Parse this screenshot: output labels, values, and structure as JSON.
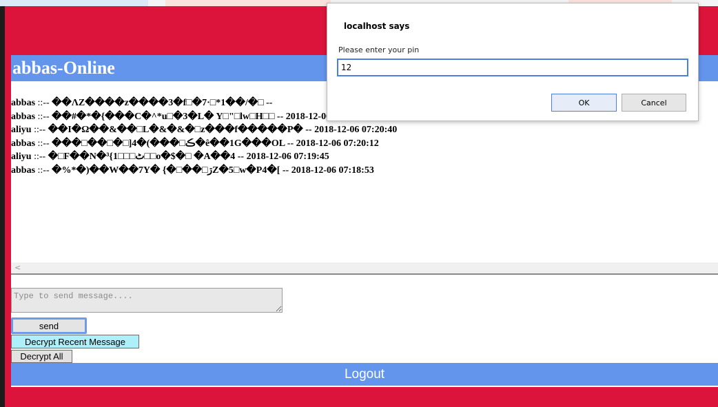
{
  "header": {
    "title": "abbas-Online"
  },
  "messages": [
    {
      "sender": "abbas",
      "separator": " ::-- ",
      "body": "��ΛZ����z����3�f□�7·□*1��/�□ --",
      "timestamp": ""
    },
    {
      "sender": "abbas",
      "separator": " ::-- ",
      "body": "��#�*�{���C�^*u□�3�L� Y□\"□lw□H□□ --",
      "timestamp": "2018-12-06 07:21:33"
    },
    {
      "sender": "aliyu",
      "separator": " ::-- ",
      "body": "��I�Ω��&��□L�&�&�□z���f�����P� --",
      "timestamp": "2018-12-06 07:20:40"
    },
    {
      "sender": "abbas",
      "separator": " ::-- ",
      "body": "���□��□�□]4�(���□ڪ�ê��1G���OL --",
      "timestamp": "2018-12-06 07:20:12"
    },
    {
      "sender": "aliyu",
      "separator": " ::-- ",
      "body": "�□F��N�³{ٹ□□□1□□o�$�□ �A��4 --",
      "timestamp": "2018-12-06 07:19:45"
    },
    {
      "sender": "abbas",
      "separator": " ::-- ",
      "body": "�%*�)��W��7Y� {�□��□ڗZ�5□w�P4�[ --",
      "timestamp": "2018-12-06 07:18:53"
    }
  ],
  "composer": {
    "placeholder": "Type to send message....",
    "send_label": "send",
    "decrypt_recent_label": "Decrypt Recent Message",
    "decrypt_all_label": "Decrypt All"
  },
  "footer": {
    "logout_label": "Logout"
  },
  "scrollbar": {
    "left_arrow": "<"
  },
  "dialog": {
    "title": "localhost says",
    "message": "Please enter your pin",
    "input_value": "12",
    "ok_label": "OK",
    "cancel_label": "Cancel"
  },
  "colors": {
    "page_background": "#dc143c",
    "header_bar": "#6495ed",
    "decrypt_recent_button": "#aef0fa"
  }
}
